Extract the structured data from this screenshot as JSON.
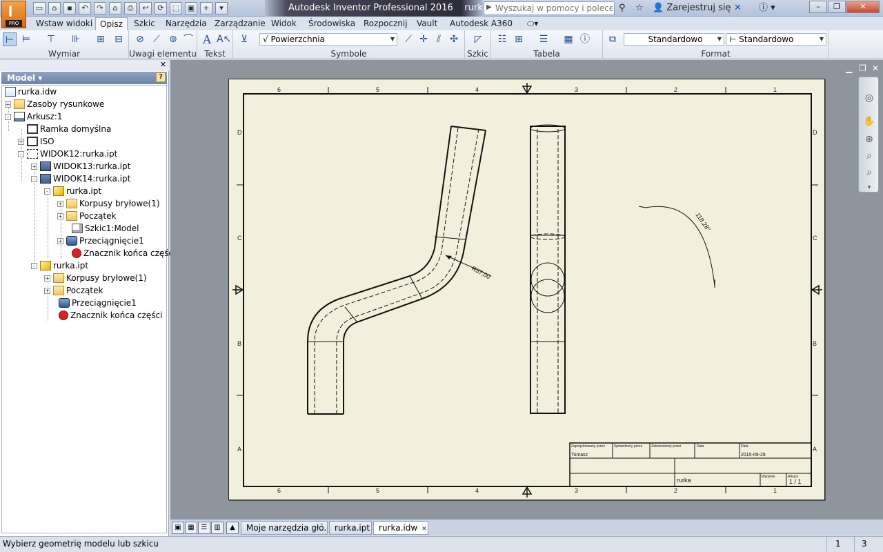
{
  "window": {
    "title": "Autodesk Inventor Professional 2016",
    "document": "rurka.idw",
    "app_logo_letter": "I",
    "app_logo_badge": "PRO",
    "search_placeholder": "Wyszukaj w pomocy i polecenia",
    "signin_label": "Zarejestruj się",
    "help_label": "?"
  },
  "menu_tabs": [
    {
      "label": "Wstaw widoki",
      "active": false
    },
    {
      "label": "Opisz",
      "active": true
    },
    {
      "label": "Szkic",
      "active": false
    },
    {
      "label": "Narzędzia",
      "active": false
    },
    {
      "label": "Zarządzanie",
      "active": false
    },
    {
      "label": "Widok",
      "active": false
    },
    {
      "label": "Środowiska",
      "active": false
    },
    {
      "label": "Rozpocznij",
      "active": false
    },
    {
      "label": "Vault",
      "active": false
    },
    {
      "label": "Autodesk A360",
      "active": false
    }
  ],
  "ribbon": {
    "panels": {
      "dimension": "Wymiar",
      "feature_notes": "Uwagi elementu",
      "text": "Tekst",
      "symbols": "Symbole",
      "sketch": "Szkic",
      "table": "Tabela",
      "format": "Format"
    },
    "surface_combo": "Powierzchnia",
    "style_combo": "Standardowo",
    "layer_combo": "Standardowo"
  },
  "browser": {
    "title": "Model",
    "help": "?",
    "tree": [
      {
        "label": "rurka.idw",
        "icon": "doc-icon",
        "level": 0,
        "expander": ""
      },
      {
        "label": "Zasoby rysunkowe",
        "icon": "folder-icon",
        "level": 0,
        "expander": "+"
      },
      {
        "label": "Arkusz:1",
        "icon": "sheet-icon",
        "level": 0,
        "expander": "-"
      },
      {
        "label": "Ramka domyślna",
        "icon": "frame-icon",
        "level": 1,
        "expander": ""
      },
      {
        "label": "ISO",
        "icon": "frame-icon",
        "level": 1,
        "expander": "+"
      },
      {
        "label": "WIDOK12:rurka.ipt",
        "icon": "view-icon",
        "level": 1,
        "expander": "-"
      },
      {
        "label": "WIDOK13:rurka.ipt",
        "icon": "view2-icon",
        "level": 2,
        "expander": "+"
      },
      {
        "label": "WIDOK14:rurka.ipt",
        "icon": "view2-icon",
        "level": 2,
        "expander": "-"
      },
      {
        "label": "rurka.ipt",
        "icon": "part-icon",
        "level": 3,
        "expander": "-"
      },
      {
        "label": "Korpusy bryłowe(1)",
        "icon": "folder-icon",
        "level": 4,
        "expander": "+"
      },
      {
        "label": "Początek",
        "icon": "folder-icon",
        "level": 4,
        "expander": "+"
      },
      {
        "label": "Szkic1:Model",
        "icon": "sketch-icon",
        "level": 4,
        "expander": ""
      },
      {
        "label": "Przeciągnięcie1",
        "icon": "sweep-icon",
        "level": 4,
        "expander": "+"
      },
      {
        "label": "Znacznik końca części",
        "icon": "end-icon",
        "level": 4,
        "expander": ""
      },
      {
        "label": "rurka.ipt",
        "icon": "part-icon",
        "level": 2,
        "expander": "-"
      },
      {
        "label": "Korpusy bryłowe(1)",
        "icon": "folder-icon",
        "level": 3,
        "expander": "+"
      },
      {
        "label": "Początek",
        "icon": "folder-icon",
        "level": 3,
        "expander": "+"
      },
      {
        "label": "Przeciągnięcie1",
        "icon": "sweep-icon",
        "level": 3,
        "expander": ""
      },
      {
        "label": "Znacznik końca części",
        "icon": "end-icon",
        "level": 3,
        "expander": ""
      }
    ]
  },
  "drawing": {
    "zone_columns": [
      "6",
      "5",
      "4",
      "3",
      "2",
      "1"
    ],
    "zone_rows": [
      "D",
      "C",
      "B",
      "A"
    ],
    "radius_dim": "R37,00",
    "angle_dim": "118,28°",
    "title_block": {
      "prepared_by_label": "Zaprojektowany przez",
      "prepared_by_value": "Tomasz",
      "checked_by_label": "Sprawdzony przez",
      "approved_by_label": "Zatwierdzony przez",
      "date_label_1": "Data",
      "date_label_2": "Data",
      "date_value": "2015-09-28",
      "title_value": "rurka",
      "edition_label": "Wydanie",
      "sheet_label": "Arkusz",
      "sheet_value": "1 / 1"
    }
  },
  "doc_tabs": [
    {
      "label": "Moje narzędzia głó...",
      "active": false
    },
    {
      "label": "rurka.ipt",
      "active": false
    },
    {
      "label": "rurka.idw",
      "active": true
    }
  ],
  "status": {
    "message": "Wybierz geometrię modelu lub szkicu",
    "count_a": "1",
    "count_b": "3"
  },
  "colors": {
    "sheet_bg": "#f2f0dc",
    "canvas_bg": "#8f959d",
    "accent": "#1e4a8a"
  }
}
